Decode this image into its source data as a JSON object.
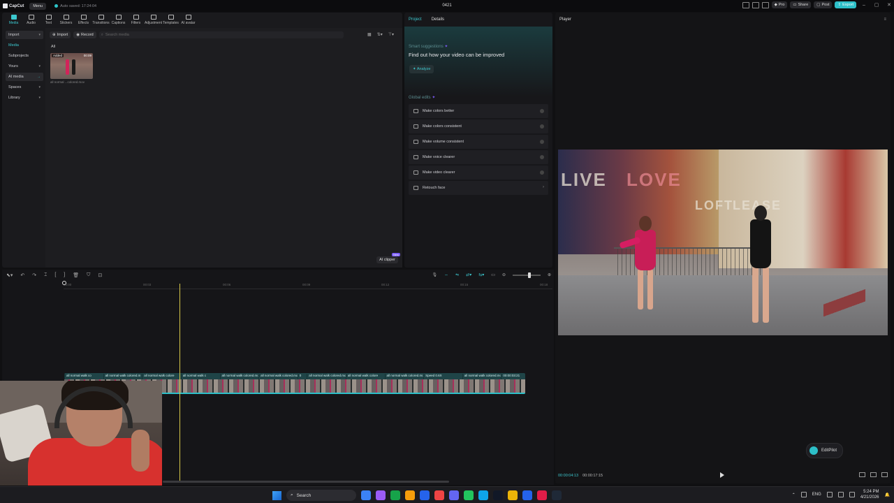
{
  "app": {
    "logo": "CapCut",
    "menu_label": "Menu",
    "autosave": "Auto saved: 17:24:04",
    "project_title": "0421",
    "pro_label": "Pro",
    "share_label": "Share",
    "post_label": "Post",
    "export_label": "Export"
  },
  "toolbar": {
    "tools": [
      "Media",
      "Audio",
      "Text",
      "Stickers",
      "Effects",
      "Transitions",
      "Captions",
      "Filters",
      "Adjustment",
      "Templates",
      "AI avatar"
    ]
  },
  "sidebar": {
    "items": [
      {
        "label": "Import"
      },
      {
        "label": "Media"
      },
      {
        "label": "Subprojects"
      },
      {
        "label": "Yours"
      },
      {
        "label": "AI media"
      },
      {
        "label": "Spaces"
      },
      {
        "label": "Library"
      }
    ]
  },
  "media": {
    "import_label": "Import",
    "record_label": "Record",
    "search_placeholder": "Search media",
    "filter_all": "All",
    "clip_badge": "Added",
    "clip_duration": "00:09",
    "clip_name": "all normal ...colored.mov",
    "ai_clipper_label": "AI clipper",
    "ai_clipper_badge": "New"
  },
  "project_panel": {
    "tab_project": "Project",
    "tab_details": "Details",
    "smart_title": "Smart suggestions",
    "smart_heading": "Find out how your video can be improved",
    "analyze_label": "Analyze",
    "global_title": "Global edits",
    "global_edits": [
      {
        "label": "Make colors better"
      },
      {
        "label": "Make colors consistent"
      },
      {
        "label": "Make volume consistent"
      },
      {
        "label": "Make voice clearer"
      },
      {
        "label": "Make video clearer"
      },
      {
        "label": "Retouch face"
      }
    ]
  },
  "player": {
    "title": "Player",
    "video_text": [
      "LIVE",
      "LOVE",
      "LOFT",
      "LEASE"
    ],
    "current_time": "00:00:04:13",
    "total_time": "00:00:17:15",
    "editpilot_label": "EditPilot"
  },
  "timeline": {
    "ruler_ticks": [
      "00:00",
      "00:03",
      "00:06",
      "00:09",
      "00:12",
      "00:15",
      "00:18"
    ],
    "clip_labels": [
      "all normal walk co",
      "all normal walk colored.m",
      "all normal walk colore",
      "all normal walk c",
      "all normal walk colored.mov",
      "all normal walk colored.mov",
      "0",
      "all normal walk colored.mo",
      "all normal walk colore",
      "all normal walk colored.mov",
      "Speed 0.6X",
      "all normal walk colored.mov",
      "00:00:03:21"
    ]
  },
  "taskbar": {
    "search_placeholder": "Search",
    "language": "ENG",
    "time": "5:24 PM",
    "date": "4/21/2026",
    "app_colors": [
      "#3b82f6",
      "#9b5cf6",
      "#16a34a",
      "#f59e0b",
      "#2563eb",
      "#ef4444",
      "#6366f1",
      "#22c55e",
      "#0ea5e9",
      "#111827",
      "#eab308",
      "#2563eb",
      "#e11d48",
      "#1f2937"
    ]
  }
}
